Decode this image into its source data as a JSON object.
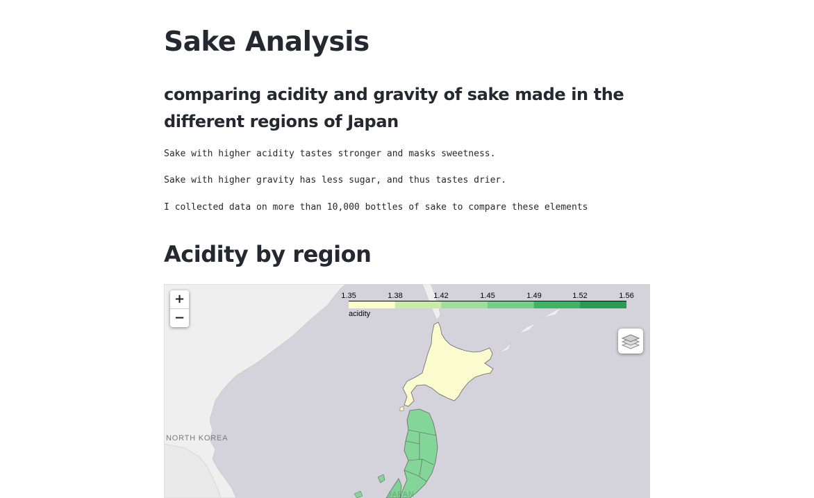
{
  "header": {
    "title": "Sake Analysis",
    "subtitle": "comparing acidity and gravity of sake made in the different regions of Japan"
  },
  "intro": {
    "paragraphs": [
      "Sake with higher acidity tastes stronger and masks sweetness.",
      "Sake with higher gravity has less sugar, and thus tastes drier.",
      "I collected data on more than 10,000 bottles of sake to compare these elements"
    ]
  },
  "section": {
    "heading": "Acidity by region"
  },
  "map": {
    "zoom_in_label": "+",
    "zoom_out_label": "−",
    "layers_icon": "layers-icon",
    "legend": {
      "name": "acidity",
      "ticks": [
        "1.35",
        "1.38",
        "1.42",
        "1.45",
        "1.49",
        "1.52",
        "1.56"
      ],
      "colors": [
        "#fcfccd",
        "#c9ebaa",
        "#9edd9b",
        "#75ce87",
        "#3fb466",
        "#2a9a55",
        "#1f7a44"
      ]
    },
    "labels": {
      "north_korea": "NORTH KOREA",
      "japan": "JAPAN"
    },
    "colors": {
      "water": "#d4d2da",
      "land": "#efefef",
      "hokkaido_fill": "#fafbce",
      "tohoku_fill": "#84d698",
      "border": "#666666"
    }
  }
}
